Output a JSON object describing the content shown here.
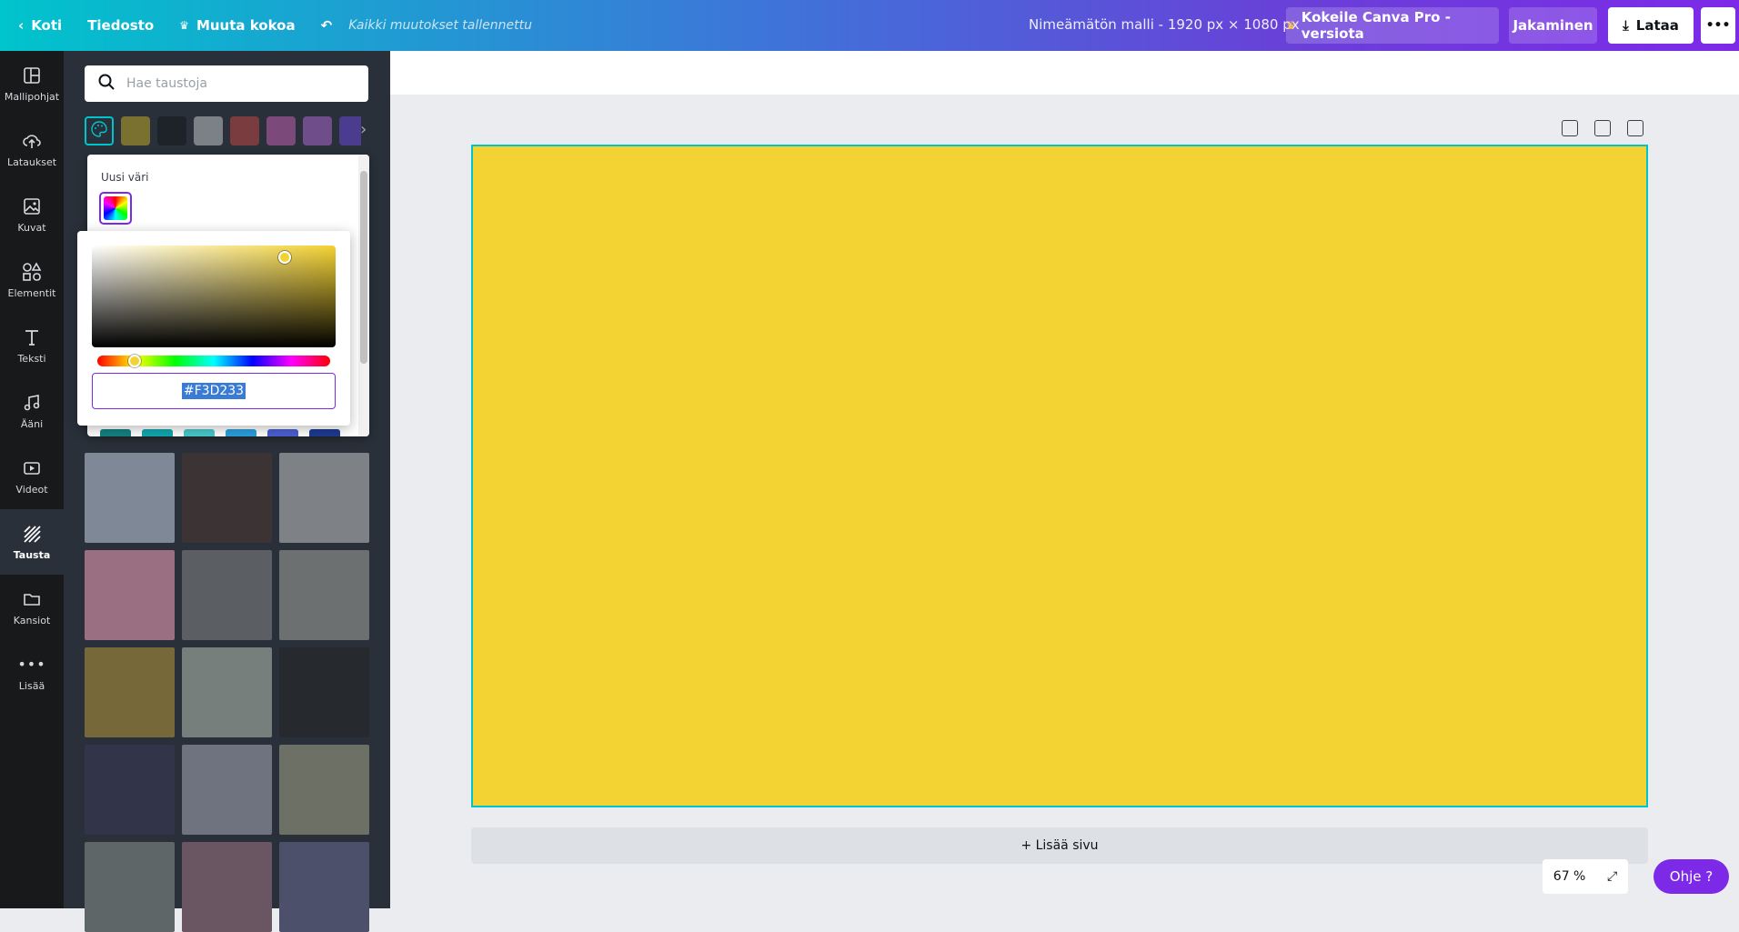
{
  "topbar": {
    "home": "Koti",
    "file": "Tiedosto",
    "resize": "Muuta kokoa",
    "saved": "Kaikki muutokset tallennettu",
    "title": "Nimeämätön malli - 1920 px × 1080 px",
    "pro": "Kokeile Canva Pro -versiota",
    "share": "Jakaminen",
    "download": "Lataa",
    "more": "•••"
  },
  "rail": [
    {
      "label": "Mallipohjat",
      "icon": "templates-icon"
    },
    {
      "label": "Lataukset",
      "icon": "upload-icon"
    },
    {
      "label": "Kuvat",
      "icon": "photos-icon"
    },
    {
      "label": "Elementit",
      "icon": "elements-icon"
    },
    {
      "label": "Teksti",
      "icon": "text-icon"
    },
    {
      "label": "Ääni",
      "icon": "audio-icon"
    },
    {
      "label": "Videot",
      "icon": "video-icon"
    },
    {
      "label": "Tausta",
      "icon": "background-icon"
    },
    {
      "label": "Kansiot",
      "icon": "folder-icon"
    },
    {
      "label": "Lisää",
      "icon": "more-icon"
    }
  ],
  "panel": {
    "search_placeholder": "Hae taustoja",
    "swatches": [
      "#7a7130",
      "#1e2329",
      "#7c8087",
      "#7a3c3f",
      "#7b4a7a",
      "#6e4d8a",
      "#4b3c8f"
    ],
    "new_color_label": "Uusi väri",
    "hex_value": "#F3D233",
    "bottom_swatches": [
      "#14807f",
      "#12a5ad",
      "#48c7c9",
      "#2b9fd9",
      "#4a5fd0",
      "#1d3a8f"
    ],
    "tiles": [
      "#7f8896",
      "#3c3434",
      "#7e8287",
      "#9a6f82",
      "#5b5f63",
      "#6d7071",
      "#77683a",
      "#777f7c",
      "#26292d",
      "#32344a",
      "#6f7380",
      "#6d7064",
      "#5e6668",
      "#6a5663",
      "#4c506a"
    ]
  },
  "canvas": {
    "color": "#F3D233",
    "add_page": "+ Lisää sivu"
  },
  "zoom": "67 %",
  "help": "Ohje ?"
}
